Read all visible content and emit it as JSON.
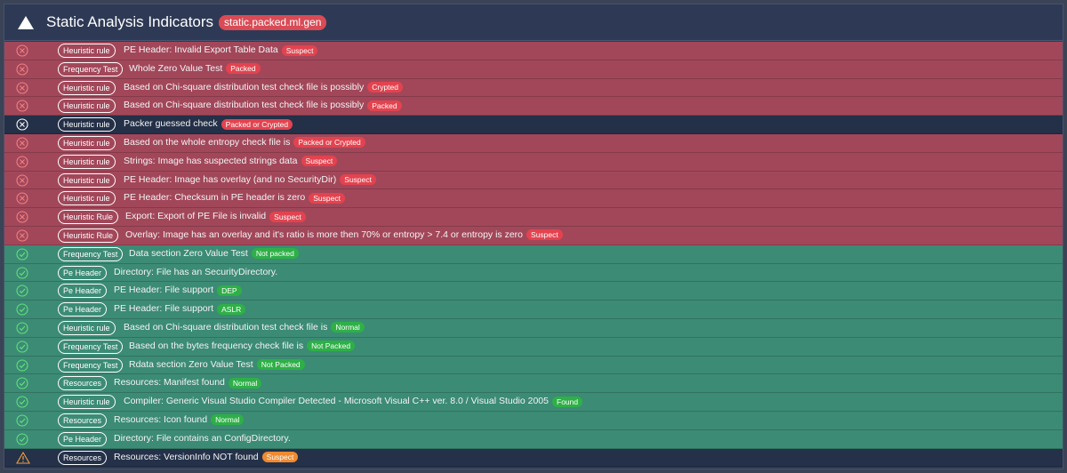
{
  "header": {
    "title": "Static Analysis Indicators",
    "tag": "static.packed.ml.gen"
  },
  "rows": [
    {
      "status": "bad",
      "category": "Heuristic rule",
      "text": "PE Header: Invalid Export Table Data",
      "badge": "Suspect",
      "badge_color": "red"
    },
    {
      "status": "bad",
      "category": "Frequency Test",
      "text": "Whole Zero Value Test",
      "badge": "Packed",
      "badge_color": "red"
    },
    {
      "status": "bad",
      "category": "Heuristic rule",
      "text": "Based on Chi-square distribution test check file is possibly",
      "badge": "Crypted",
      "badge_color": "red"
    },
    {
      "status": "bad",
      "category": "Heuristic rule",
      "text": "Based on Chi-square distribution test check file is possibly",
      "badge": "Packed",
      "badge_color": "red"
    },
    {
      "status": "sel",
      "category": "Heuristic rule",
      "text": "Packer guessed check",
      "badge": "Packed or Crypted",
      "badge_color": "red"
    },
    {
      "status": "bad",
      "category": "Heuristic rule",
      "text": "Based on the whole entropy check file is",
      "badge": "Packed or Crypted",
      "badge_color": "red"
    },
    {
      "status": "bad",
      "category": "Heuristic rule",
      "text": "Strings: Image has suspected strings data",
      "badge": "Suspect",
      "badge_color": "red"
    },
    {
      "status": "bad",
      "category": "Heuristic rule",
      "text": "PE Header: Image has overlay (and no SecurityDir)",
      "badge": "Suspect",
      "badge_color": "red"
    },
    {
      "status": "bad",
      "category": "Heuristic rule",
      "text": "PE Header: Checksum in PE header is zero",
      "badge": "Suspect",
      "badge_color": "red"
    },
    {
      "status": "bad",
      "category": "Heuristic Rule",
      "text": "Export: Export of PE File is invalid",
      "badge": "Suspect",
      "badge_color": "red"
    },
    {
      "status": "bad",
      "category": "Heuristic Rule",
      "text": "Overlay: Image has an overlay and it's ratio is more then 70% or entropy > 7.4 or entropy is zero",
      "badge": "Suspect",
      "badge_color": "red"
    },
    {
      "status": "good",
      "category": "Frequency Test",
      "text": "Data section Zero Value Test",
      "badge": "Not packed",
      "badge_color": "green"
    },
    {
      "status": "good",
      "category": "Pe Header",
      "text": "Directory: File has an SecurityDirectory.",
      "badge": "",
      "badge_color": "green"
    },
    {
      "status": "good",
      "category": "Pe Header",
      "text": "PE Header: File support",
      "badge": "DEP",
      "badge_color": "green"
    },
    {
      "status": "good",
      "category": "Pe Header",
      "text": "PE Header: File support",
      "badge": "ASLR",
      "badge_color": "green"
    },
    {
      "status": "good",
      "category": "Heuristic rule",
      "text": "Based on Chi-square distribution test check file is",
      "badge": "Normal",
      "badge_color": "green"
    },
    {
      "status": "good",
      "category": "Frequency Test",
      "text": "Based on the bytes frequency check file is",
      "badge": "Not Packed",
      "badge_color": "green"
    },
    {
      "status": "good",
      "category": "Frequency Test",
      "text": "Rdata section Zero Value Test",
      "badge": "Not Packed",
      "badge_color": "green"
    },
    {
      "status": "good",
      "category": "Resources",
      "text": "Resources: Manifest found",
      "badge": "Normal",
      "badge_color": "green"
    },
    {
      "status": "good",
      "category": "Heuristic rule",
      "text": "Compiler: Generic Visual Studio Compiler Detected - Microsoft Visual C++ ver. 8.0 / Visual Studio 2005",
      "badge": "Found",
      "badge_color": "green"
    },
    {
      "status": "good",
      "category": "Resources",
      "text": "Resources: Icon found",
      "badge": "Normal",
      "badge_color": "green"
    },
    {
      "status": "good",
      "category": "Pe Header",
      "text": "Directory: File contains an ConfigDirectory.",
      "badge": "",
      "badge_color": "green"
    },
    {
      "status": "warn",
      "category": "Resources",
      "text": "Resources: VersionInfo NOT found",
      "badge": "Suspect",
      "badge_color": "orange"
    }
  ]
}
